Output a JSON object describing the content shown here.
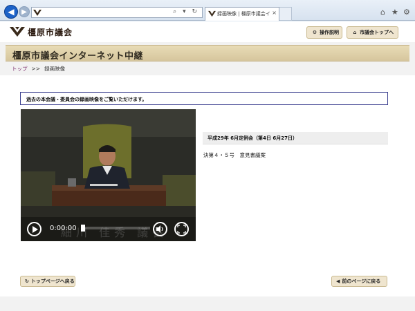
{
  "browser": {
    "tab_title": "録画映像 | 橿原市議会イン...",
    "tab_close": "×",
    "address_tools": "⌕ ▾ ↻"
  },
  "header": {
    "logo_text": "橿原市議会",
    "howto_label": "操作説明",
    "city_top_label": "市議会トップへ"
  },
  "site_title": "橿原市議会インターネット中継",
  "breadcrumb": {
    "top": "トップ",
    "separator": ">>",
    "current": "録画映像"
  },
  "intro": "過去の本会議・委員会の録画映像をご覧いただけます。",
  "video": {
    "time": "0:00:00",
    "progress": 0.0,
    "caption": "細川 佳秀 議長"
  },
  "session": "平成29年 6月定例会（第4日 6月27日）",
  "agenda": "決第４・５号　意見書議案",
  "footer_buttons": {
    "back_to_top": "トップページへ戻る",
    "prev_page": "前のページに戻る"
  },
  "colors": {
    "accent_gold": "#d6c69d",
    "button_bg": "#efe5cf",
    "link_purple": "#7a2a6a",
    "intro_border": "#3b3f8f"
  }
}
